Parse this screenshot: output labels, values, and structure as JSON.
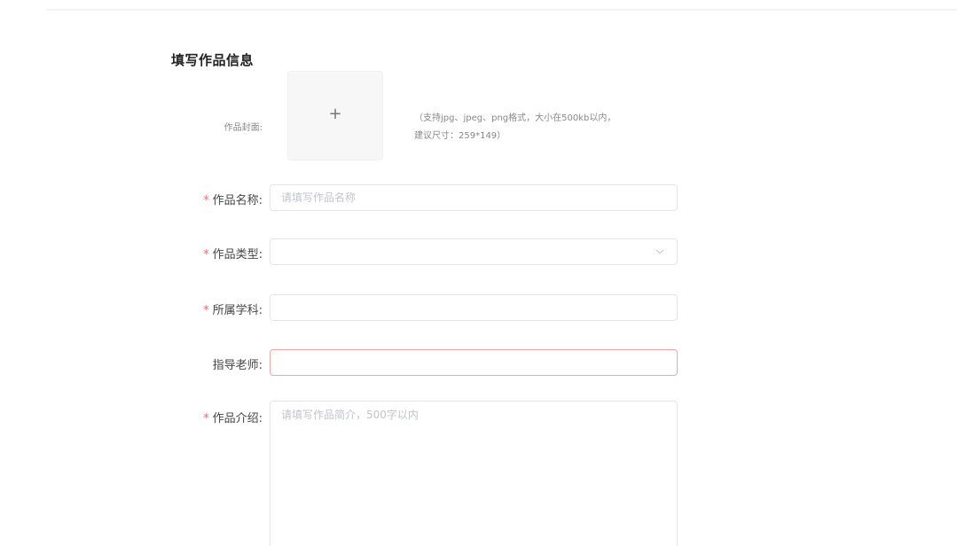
{
  "form": {
    "title": "填写作品信息",
    "cover": {
      "label": "作品封面:",
      "upload_symbol": "+",
      "hint_line1": "（支持jpg、jpeg、png格式，大小在500kb以内，",
      "hint_line2": "建议尺寸：259*149）"
    },
    "fields": {
      "name": {
        "required_mark": "*",
        "label": "作品名称:",
        "placeholder": "请填写作品名称",
        "value": ""
      },
      "type": {
        "required_mark": "*",
        "label": "作品类型:",
        "value": ""
      },
      "subject": {
        "required_mark": "*",
        "label": "所属学科:",
        "value": ""
      },
      "advisor": {
        "label": "指导老师:",
        "value": ""
      },
      "intro": {
        "required_mark": "*",
        "label": "作品介绍:",
        "placeholder": "请填写作品简介，500字以内",
        "value": ""
      }
    }
  },
  "icons": {
    "upload": "plus-icon",
    "dropdown": "chevron-down-icon"
  },
  "colors": {
    "required": "#f56c6c",
    "error_border": "#f5a3a3",
    "border": "#e4e4e4",
    "placeholder": "#c0c4cc"
  }
}
